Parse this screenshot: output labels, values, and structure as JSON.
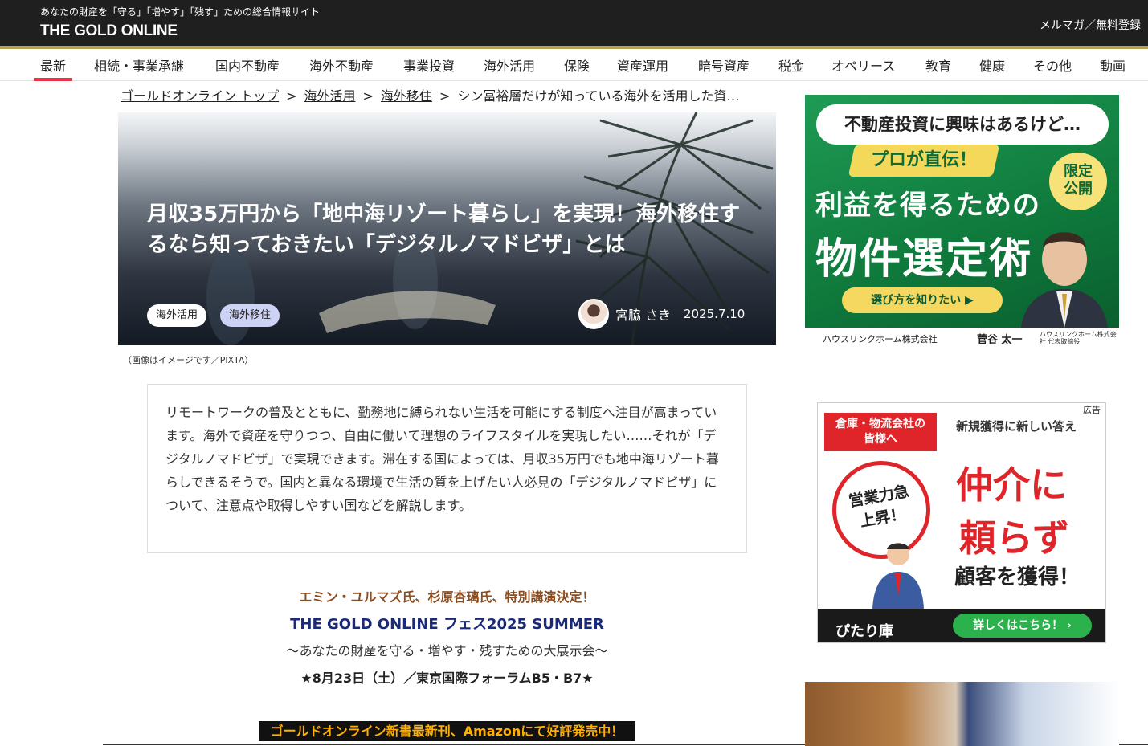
{
  "header": {
    "tagline": "あなたの財産を「守る」「増やす」「残す」ための総合情報サイト",
    "logo": "THE GOLD ONLINE",
    "mailmag": "メルマガ／無料登録"
  },
  "nav": {
    "items": [
      {
        "label": "最新",
        "active": true
      },
      {
        "label": "相続・事業承継"
      },
      {
        "label": "国内不動産"
      },
      {
        "label": "海外不動産"
      },
      {
        "label": "事業投資"
      },
      {
        "label": "海外活用"
      },
      {
        "label": "保険"
      },
      {
        "label": "資産運用"
      },
      {
        "label": "暗号資産"
      },
      {
        "label": "税金"
      },
      {
        "label": "オペリース"
      },
      {
        "label": "教育"
      },
      {
        "label": "健康"
      },
      {
        "label": "その他"
      },
      {
        "label": "動画"
      }
    ]
  },
  "breadcrumb": {
    "items": [
      "ゴールドオンライン トップ",
      "海外活用",
      "海外移住"
    ],
    "current": "シン冨裕層だけが知っている海外を活用した資…",
    "separator": ">"
  },
  "article": {
    "title": "月収35万円から「地中海リゾート暮らし」を実現！海外移住するなら知っておきたい「デジタルノマドビザ」とは",
    "tags": [
      "海外活用",
      "海外移住"
    ],
    "author": "宮脇 さき",
    "date": "2025.7.10",
    "image_caption": "（画像はイメージです／PIXTA）",
    "lead": "リモートワークの普及とともに、勤務地に縛られない生活を可能にする制度へ注目が高まっています。海外で資産を守りつつ、自由に働いて理想のライフスタイルを実現したい……それが「デジタルノマドビザ」で実現できます。滞在する国によっては、月収35万円でも地中海リゾート暮らしできるそうで。国内と異なる環境で生活の質を上げたい人必見の「デジタルノマドビザ」について、注意点や取得しやすい国などを解説します。"
  },
  "event": {
    "line1": "エミン・ユルマズ氏、杉原杏璃氏、特別講演決定！",
    "line2": "THE GOLD ONLINE フェス2025 SUMMER",
    "line3": "～あなたの財産を守る・増やす・残すための大展示会～",
    "line4": "★8月23日（土）／東京国際フォーラムB5・B7★"
  },
  "promo": {
    "text": "ゴールドオンライン新書最新刊、Amazonにて好評発売中！"
  },
  "ads": {
    "ad1": {
      "headline": "不動産投資に興味はあるけど…",
      "ribbon": "プロが直伝！",
      "badge": "限定公開",
      "line1": "利益を得るための",
      "line2": "物件選定術",
      "cta": "選び方を知りたい ▶",
      "company": "ハウスリンクホーム株式会社",
      "presenter": "菅谷 太一",
      "presenter_role": "ハウスリンクホーム株式会社 代表取締役"
    },
    "ad2": {
      "label": "広告",
      "redbox": "倉庫・物流会社の皆様へ",
      "heading": "新規獲得に新しい答え",
      "circle": "営業力急上昇！",
      "big1": "仲介に",
      "big2": "頼らず",
      "sub": "顧客を獲得！",
      "brand": "ぴたり庫",
      "button": "詳しくはこちら！ ›"
    }
  },
  "colors": {
    "header_bg": "#1f1f1f",
    "gold_accent": "#b59e5a",
    "nav_active": "#e6344a",
    "event_title": "#1b2a78",
    "event_highlight": "#8a4b1e",
    "promo_text": "#ffb000"
  }
}
